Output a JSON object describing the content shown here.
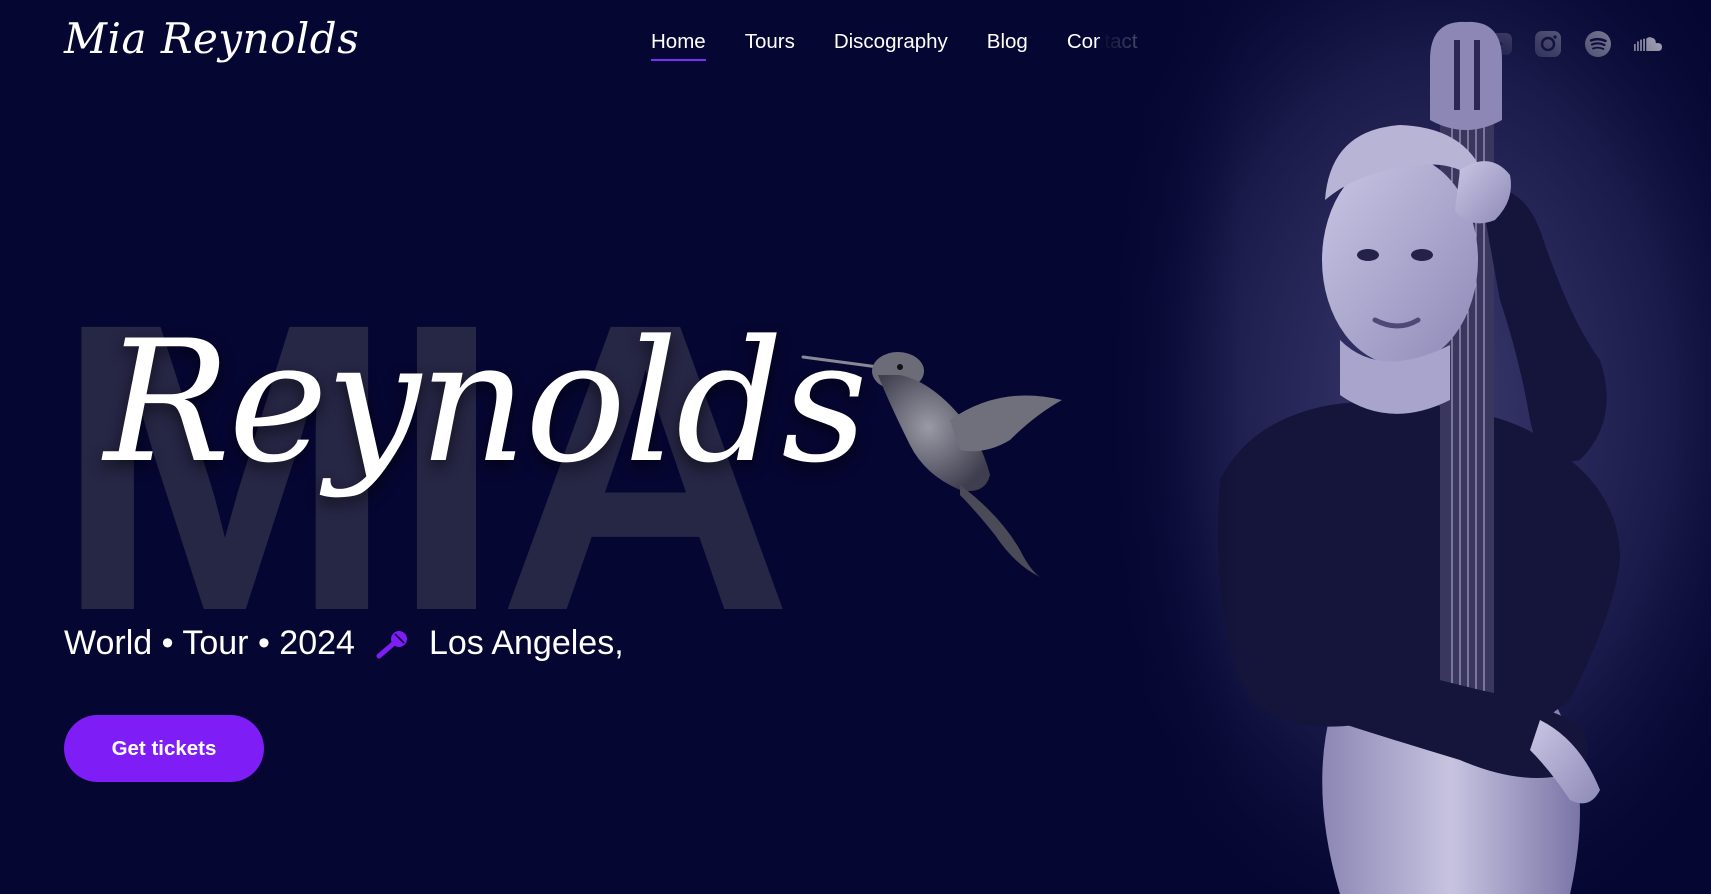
{
  "brand": {
    "name": "Mia Reynolds"
  },
  "nav": {
    "items": [
      {
        "label": "Home",
        "active": true
      },
      {
        "label": "Tours",
        "active": false
      },
      {
        "label": "Discography",
        "active": false
      },
      {
        "label": "Blog",
        "active": false
      },
      {
        "label": "Contact",
        "active": false
      }
    ]
  },
  "socials": [
    "youtube-icon",
    "instagram-icon",
    "spotify-icon",
    "soundcloud-icon"
  ],
  "hero": {
    "background_word": "MIA",
    "script_name": "Reynolds",
    "tagline_left": "World • Tour • 2024",
    "tagline_icon": "microphone-icon",
    "tagline_right": "Los Angeles,",
    "cta_label": "Get tickets"
  },
  "colors": {
    "background": "#060632",
    "accent": "#7e1df5",
    "background_word": "#262645"
  }
}
